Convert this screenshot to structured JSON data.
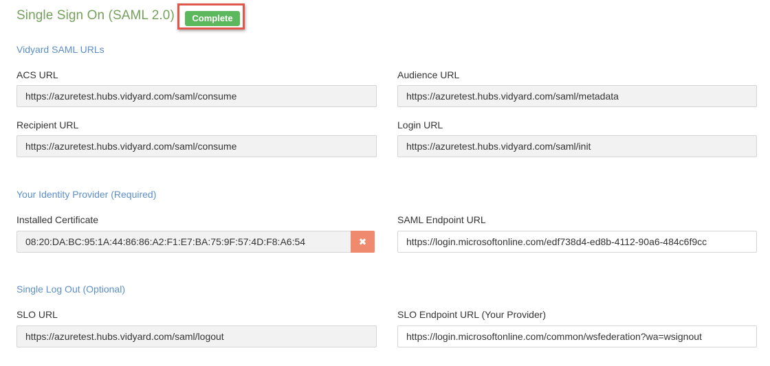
{
  "page": {
    "title": "Single Sign On (SAML 2.0)",
    "status_badge": "Complete"
  },
  "vidyard_saml": {
    "section_title": "Vidyard SAML URLs",
    "acs_url": {
      "label": "ACS URL",
      "value": "https://azuretest.hubs.vidyard.com/saml/consume"
    },
    "audience_url": {
      "label": "Audience URL",
      "value": "https://azuretest.hubs.vidyard.com/saml/metadata"
    },
    "recipient_url": {
      "label": "Recipient URL",
      "value": "https://azuretest.hubs.vidyard.com/saml/consume"
    },
    "login_url": {
      "label": "Login URL",
      "value": "https://azuretest.hubs.vidyard.com/saml/init"
    }
  },
  "identity_provider": {
    "section_title": "Your Identity Provider (Required)",
    "installed_certificate": {
      "label": "Installed Certificate",
      "value": "08:20:DA:BC:95:1A:44:86:86:A2:F1:E7:BA:75:9F:57:4D:F8:A6:54",
      "remove_glyph": "✖"
    },
    "saml_endpoint_url": {
      "label": "SAML Endpoint URL",
      "value": "https://login.microsoftonline.com/edf738d4-ed8b-4112-90a6-484c6f9cc"
    }
  },
  "single_log_out": {
    "section_title": "Single Log Out (Optional)",
    "slo_url": {
      "label": "SLO URL",
      "value": "https://azuretest.hubs.vidyard.com/saml/logout"
    },
    "slo_endpoint_url": {
      "label": "SLO Endpoint URL (Your Provider)",
      "value": "https://login.microsoftonline.com/common/wsfederation?wa=wsignout"
    }
  },
  "colors": {
    "title_green": "#74a05c",
    "badge_green": "#5cb85c",
    "section_blue": "#5b8ec9",
    "highlight_red": "#e0564a",
    "remove_button": "#f08a6f",
    "readonly_bg": "#f2f2f2"
  },
  "icons": {
    "remove_cert": "close-icon"
  }
}
